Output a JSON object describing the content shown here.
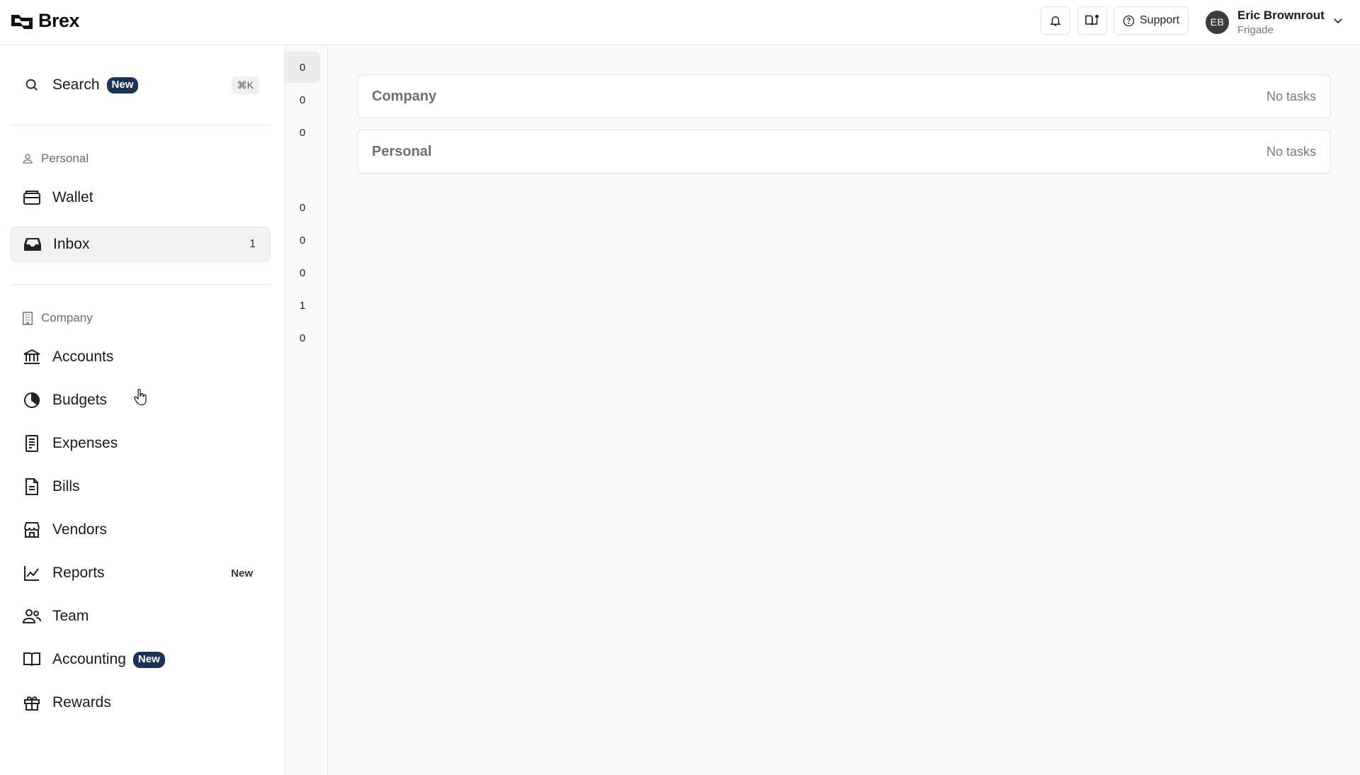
{
  "app": {
    "name": "Brex"
  },
  "header": {
    "support_label": "Support",
    "user": {
      "initials": "EB",
      "name": "Eric Brownrout",
      "org": "Frigade"
    }
  },
  "sidebar": {
    "search": {
      "label": "Search",
      "badge": "New",
      "shortcut": "⌘K"
    },
    "personal_section": "Personal",
    "personal_items": [
      {
        "label": "Wallet",
        "icon": "wallet-icon"
      },
      {
        "label": "Inbox",
        "icon": "inbox-icon",
        "count": "1"
      }
    ],
    "company_section": "Company",
    "company_items": [
      {
        "label": "Accounts",
        "icon": "bank-icon"
      },
      {
        "label": "Budgets",
        "icon": "pie-icon"
      },
      {
        "label": "Expenses",
        "icon": "receipt-icon"
      },
      {
        "label": "Bills",
        "icon": "document-icon"
      },
      {
        "label": "Vendors",
        "icon": "store-icon"
      },
      {
        "label": "Reports",
        "icon": "chart-line-icon",
        "tag": "New"
      },
      {
        "label": "Team",
        "icon": "users-icon"
      },
      {
        "label": "Accounting",
        "icon": "book-icon",
        "badge": "New"
      },
      {
        "label": "Rewards",
        "icon": "gift-icon"
      }
    ]
  },
  "counts": [
    "0",
    "0",
    "0",
    "0",
    "0",
    "0",
    "1",
    "0"
  ],
  "tasks": [
    {
      "title": "Company",
      "status": "No tasks"
    },
    {
      "title": "Personal",
      "status": "No tasks"
    }
  ]
}
